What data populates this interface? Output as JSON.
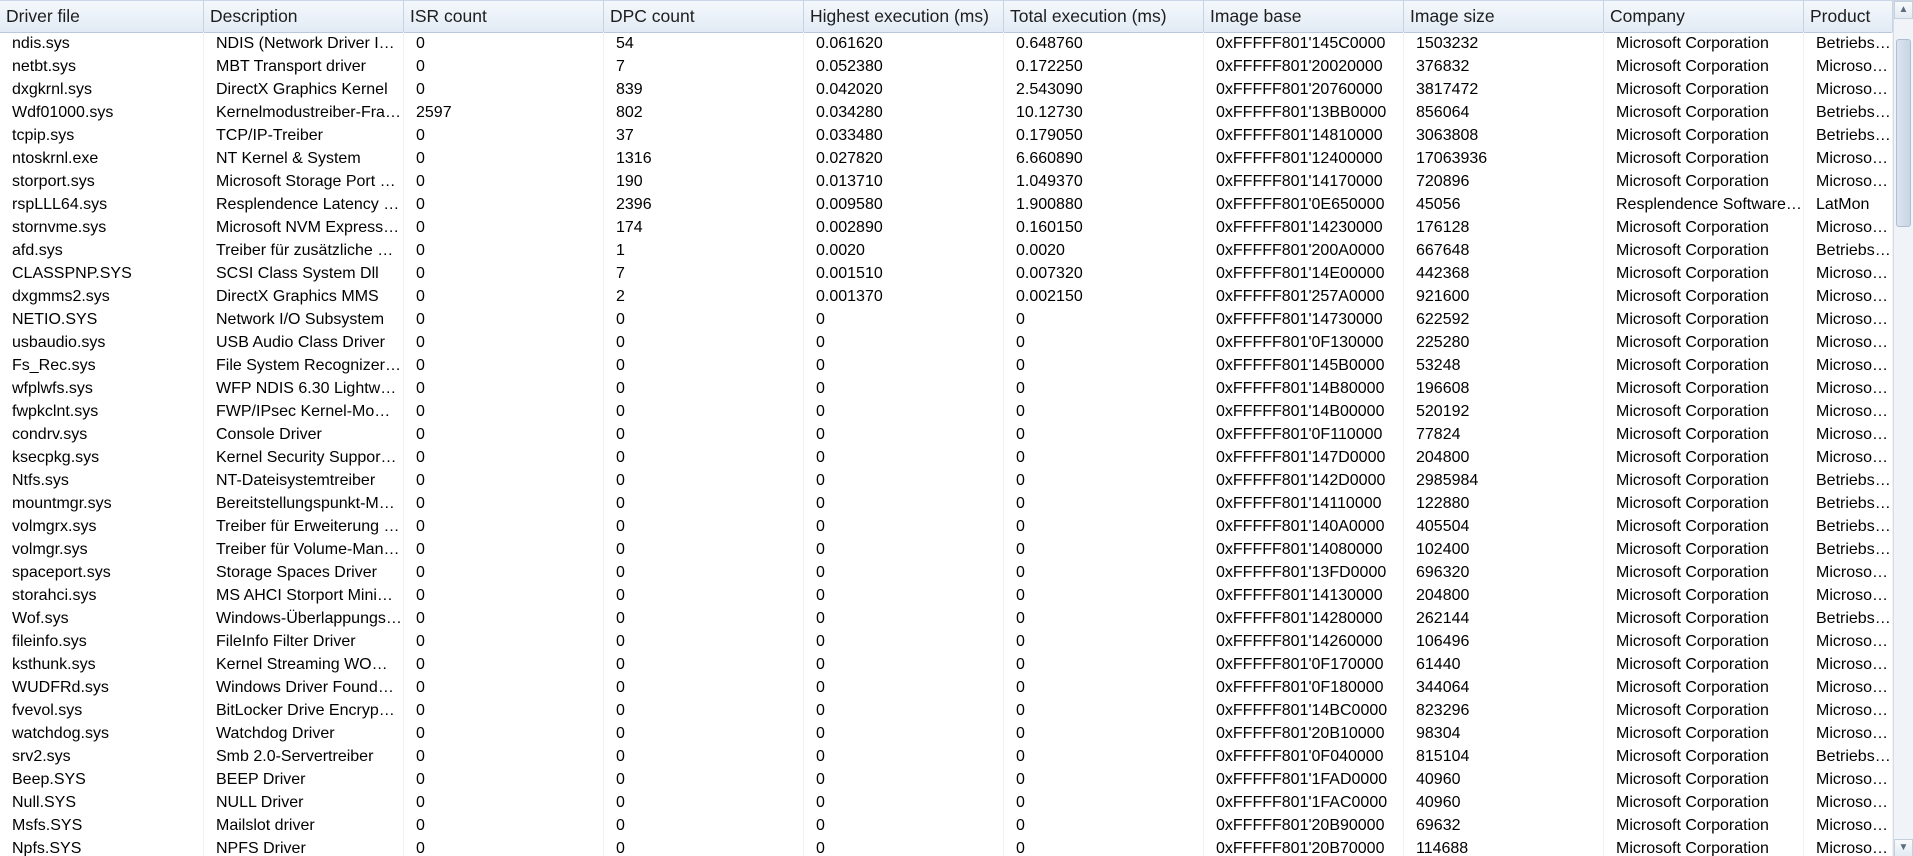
{
  "table": {
    "columns": [
      {
        "key": "driver",
        "label": "Driver file"
      },
      {
        "key": "description",
        "label": "Description"
      },
      {
        "key": "isr",
        "label": "ISR count"
      },
      {
        "key": "dpc",
        "label": "DPC count"
      },
      {
        "key": "highest",
        "label": "Highest execution (ms)"
      },
      {
        "key": "total",
        "label": "Total execution (ms)"
      },
      {
        "key": "base",
        "label": "Image base"
      },
      {
        "key": "size",
        "label": "Image size"
      },
      {
        "key": "company",
        "label": "Company"
      },
      {
        "key": "product",
        "label": "Product"
      }
    ],
    "rows": [
      [
        "ndis.sys",
        "NDIS (Network Driver I…",
        "0",
        "54",
        "0.061620",
        "0.648760",
        "0xFFFFF801'145C0000",
        "1503232",
        "Microsoft Corporation",
        "Betriebssys"
      ],
      [
        "netbt.sys",
        "MBT Transport driver",
        "0",
        "7",
        "0.052380",
        "0.172250",
        "0xFFFFF801'20020000",
        "376832",
        "Microsoft Corporation",
        "Microsoft®"
      ],
      [
        "dxgkrnl.sys",
        "DirectX Graphics Kernel",
        "0",
        "839",
        "0.042020",
        "2.543090",
        "0xFFFFF801'20760000",
        "3817472",
        "Microsoft Corporation",
        "Microsoft®"
      ],
      [
        "Wdf01000.sys",
        "Kernelmodustreiber-Fra…",
        "2597",
        "802",
        "0.034280",
        "10.12730",
        "0xFFFFF801'13BB0000",
        "856064",
        "Microsoft Corporation",
        "Betriebssys"
      ],
      [
        "tcpip.sys",
        "TCP/IP-Treiber",
        "0",
        "37",
        "0.033480",
        "0.179050",
        "0xFFFFF801'14810000",
        "3063808",
        "Microsoft Corporation",
        "Betriebssys"
      ],
      [
        "ntoskrnl.exe",
        "NT Kernel & System",
        "0",
        "1316",
        "0.027820",
        "6.660890",
        "0xFFFFF801'12400000",
        "17063936",
        "Microsoft Corporation",
        "Microsoft®"
      ],
      [
        "storport.sys",
        "Microsoft Storage Port …",
        "0",
        "190",
        "0.013710",
        "1.049370",
        "0xFFFFF801'14170000",
        "720896",
        "Microsoft Corporation",
        "Microsoft®"
      ],
      [
        "rspLLL64.sys",
        "Resplendence Latency …",
        "0",
        "2396",
        "0.009580",
        "1.900880",
        "0xFFFFF801'0E650000",
        "45056",
        "Resplendence Software…",
        "LatMon"
      ],
      [
        "stornvme.sys",
        "Microsoft NVM Express…",
        "0",
        "174",
        "0.002890",
        "0.160150",
        "0xFFFFF801'14230000",
        "176128",
        "Microsoft Corporation",
        "Microsoft®"
      ],
      [
        "afd.sys",
        "Treiber für zusätzliche …",
        "0",
        "1",
        "0.0020",
        "0.0020",
        "0xFFFFF801'200A0000",
        "667648",
        "Microsoft Corporation",
        "Betriebssys"
      ],
      [
        "CLASSPNP.SYS",
        "SCSI Class System Dll",
        "0",
        "7",
        "0.001510",
        "0.007320",
        "0xFFFFF801'14E00000",
        "442368",
        "Microsoft Corporation",
        "Microsoft®"
      ],
      [
        "dxgmms2.sys",
        "DirectX Graphics MMS",
        "0",
        "2",
        "0.001370",
        "0.002150",
        "0xFFFFF801'257A0000",
        "921600",
        "Microsoft Corporation",
        "Microsoft®"
      ],
      [
        "NETIO.SYS",
        "Network I/O Subsystem",
        "0",
        "0",
        "0",
        "0",
        "0xFFFFF801'14730000",
        "622592",
        "Microsoft Corporation",
        "Microsoft®"
      ],
      [
        "usbaudio.sys",
        "USB Audio Class Driver",
        "0",
        "0",
        "0",
        "0",
        "0xFFFFF801'0F130000",
        "225280",
        "Microsoft Corporation",
        "Microsoft®"
      ],
      [
        "Fs_Rec.sys",
        "File System Recognizer…",
        "0",
        "0",
        "0",
        "0",
        "0xFFFFF801'145B0000",
        "53248",
        "Microsoft Corporation",
        "Microsoft®"
      ],
      [
        "wfplwfs.sys",
        "WFP NDIS 6.30 Lightw…",
        "0",
        "0",
        "0",
        "0",
        "0xFFFFF801'14B80000",
        "196608",
        "Microsoft Corporation",
        "Microsoft®"
      ],
      [
        "fwpkclnt.sys",
        "FWP/IPsec Kernel-Mo…",
        "0",
        "0",
        "0",
        "0",
        "0xFFFFF801'14B00000",
        "520192",
        "Microsoft Corporation",
        "Microsoft®"
      ],
      [
        "condrv.sys",
        "Console Driver",
        "0",
        "0",
        "0",
        "0",
        "0xFFFFF801'0F110000",
        "77824",
        "Microsoft Corporation",
        "Microsoft®"
      ],
      [
        "ksecpkg.sys",
        "Kernel Security Suppor…",
        "0",
        "0",
        "0",
        "0",
        "0xFFFFF801'147D0000",
        "204800",
        "Microsoft Corporation",
        "Microsoft®"
      ],
      [
        "Ntfs.sys",
        "NT-Dateisystemtreiber",
        "0",
        "0",
        "0",
        "0",
        "0xFFFFF801'142D0000",
        "2985984",
        "Microsoft Corporation",
        "Betriebssys"
      ],
      [
        "mountmgr.sys",
        "Bereitstellungspunkt-Ma…",
        "0",
        "0",
        "0",
        "0",
        "0xFFFFF801'14110000",
        "122880",
        "Microsoft Corporation",
        "Betriebssys"
      ],
      [
        "volmgrx.sys",
        "Treiber für Erweiterung …",
        "0",
        "0",
        "0",
        "0",
        "0xFFFFF801'140A0000",
        "405504",
        "Microsoft Corporation",
        "Betriebssys"
      ],
      [
        "volmgr.sys",
        "Treiber für Volume-Man…",
        "0",
        "0",
        "0",
        "0",
        "0xFFFFF801'14080000",
        "102400",
        "Microsoft Corporation",
        "Betriebssys"
      ],
      [
        "spaceport.sys",
        "Storage Spaces Driver",
        "0",
        "0",
        "0",
        "0",
        "0xFFFFF801'13FD0000",
        "696320",
        "Microsoft Corporation",
        "Microsoft®"
      ],
      [
        "storahci.sys",
        "MS AHCI Storport Mini…",
        "0",
        "0",
        "0",
        "0",
        "0xFFFFF801'14130000",
        "204800",
        "Microsoft Corporation",
        "Microsoft®"
      ],
      [
        "Wof.sys",
        "Windows-Überlappungs…",
        "0",
        "0",
        "0",
        "0",
        "0xFFFFF801'14280000",
        "262144",
        "Microsoft Corporation",
        "Betriebssys"
      ],
      [
        "fileinfo.sys",
        "FileInfo Filter Driver",
        "0",
        "0",
        "0",
        "0",
        "0xFFFFF801'14260000",
        "106496",
        "Microsoft Corporation",
        "Microsoft®"
      ],
      [
        "ksthunk.sys",
        "Kernel Streaming WO…",
        "0",
        "0",
        "0",
        "0",
        "0xFFFFF801'0F170000",
        "61440",
        "Microsoft Corporation",
        "Microsoft®"
      ],
      [
        "WUDFRd.sys",
        "Windows Driver Found…",
        "0",
        "0",
        "0",
        "0",
        "0xFFFFF801'0F180000",
        "344064",
        "Microsoft Corporation",
        "Microsoft®"
      ],
      [
        "fvevol.sys",
        "BitLocker Drive Encryp…",
        "0",
        "0",
        "0",
        "0",
        "0xFFFFF801'14BC0000",
        "823296",
        "Microsoft Corporation",
        "Microsoft®"
      ],
      [
        "watchdog.sys",
        "Watchdog Driver",
        "0",
        "0",
        "0",
        "0",
        "0xFFFFF801'20B10000",
        "98304",
        "Microsoft Corporation",
        "Microsoft®"
      ],
      [
        "srv2.sys",
        "Smb 2.0-Servertreiber",
        "0",
        "0",
        "0",
        "0",
        "0xFFFFF801'0F040000",
        "815104",
        "Microsoft Corporation",
        "Betriebssys"
      ],
      [
        "Beep.SYS",
        "BEEP Driver",
        "0",
        "0",
        "0",
        "0",
        "0xFFFFF801'1FAD0000",
        "40960",
        "Microsoft Corporation",
        "Microsoft®"
      ],
      [
        "Null.SYS",
        "NULL Driver",
        "0",
        "0",
        "0",
        "0",
        "0xFFFFF801'1FAC0000",
        "40960",
        "Microsoft Corporation",
        "Microsoft®"
      ],
      [
        "Msfs.SYS",
        "Mailslot driver",
        "0",
        "0",
        "0",
        "0",
        "0xFFFFF801'20B90000",
        "69632",
        "Microsoft Corporation",
        "Microsoft®"
      ],
      [
        "Npfs.SYS",
        "NPFS Driver",
        "0",
        "0",
        "0",
        "0",
        "0xFFFFF801'20B70000",
        "114688",
        "Microsoft Corporation",
        "Microsoft®"
      ]
    ]
  },
  "scrollbar": {
    "up_icon": "triangle-up",
    "down_icon": "triangle-down"
  }
}
